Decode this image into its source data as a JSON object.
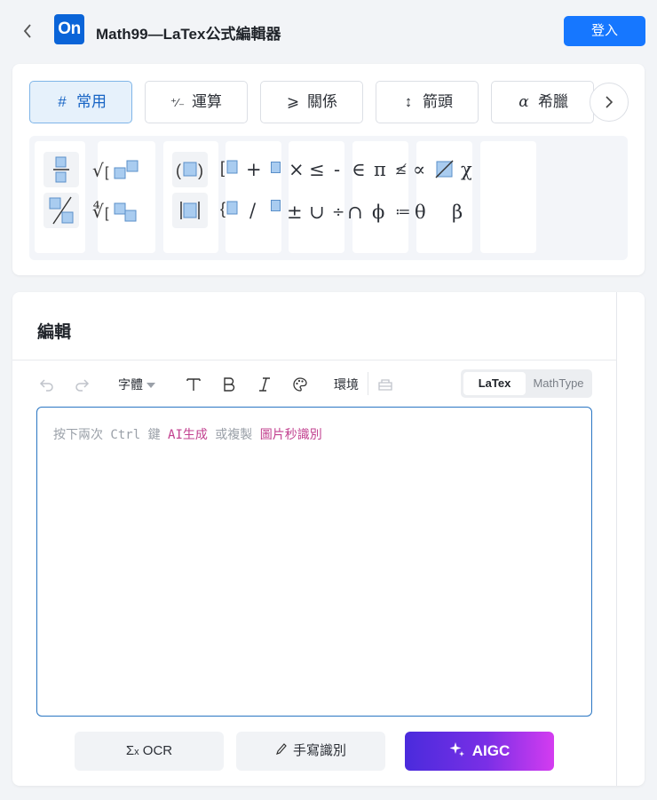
{
  "header": {
    "back_icon": "chevron-left-icon",
    "logo_text": "On",
    "title": "Math99—LaTex公式編輯器",
    "login_label": "登入"
  },
  "tabs": [
    {
      "icon": "#",
      "label": "常用",
      "active": true
    },
    {
      "icon": "⁺⁄₋",
      "label": "運算",
      "active": false
    },
    {
      "icon": "⩾",
      "label": "關係",
      "active": false
    },
    {
      "icon": "↕",
      "label": "箭頭",
      "active": false
    },
    {
      "icon": "α",
      "label": "希臘",
      "active": false
    }
  ],
  "tab_next_icon": "chevron-right-icon",
  "symbols": {
    "row1": [
      "+",
      "×",
      "≤",
      "-",
      "∈",
      "π",
      "≰",
      "∝",
      "χ"
    ],
    "row2": [
      "/",
      "±",
      "∪",
      "÷",
      "∩",
      "ϕ",
      "≔",
      "θ",
      "β"
    ]
  },
  "editor": {
    "title": "編輯",
    "font_label": "字體",
    "env_label": "環境",
    "mode_latex": "LaTex",
    "mode_mathtype": "MathType",
    "hint_prefix": "按下兩次 Ctrl 鍵 ",
    "hint_ai": "AI生成",
    "hint_mid": " 或複製 ",
    "hint_ocr": "圖片秒識別"
  },
  "actions": {
    "ocr_label": "OCR",
    "handwrite_label": "手寫識別",
    "aigc_label": "AIGC"
  },
  "colors": {
    "primary": "#1677ff",
    "logo": "#0a64d8",
    "tab_active_bg": "#e6f1fb",
    "hint_accent": "#c2408f"
  }
}
